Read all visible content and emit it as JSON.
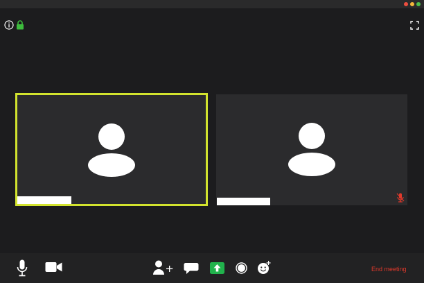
{
  "window": {
    "controls": [
      "close",
      "minimize",
      "maximize"
    ]
  },
  "top_bar": {
    "icons": [
      "info-icon",
      "lock-icon",
      "fullscreen-icon"
    ],
    "lock_color": "#3dbd3d"
  },
  "participants": [
    {
      "tile": "participant-tile-1",
      "active_speaker": true,
      "highlight_color": "#d2e32e",
      "muted": false
    },
    {
      "tile": "participant-tile-2",
      "active_speaker": false,
      "muted": true,
      "muted_icon_color": "#e1392b"
    }
  ],
  "toolbar": {
    "left_icons": [
      "microphone-icon",
      "video-camera-icon"
    ],
    "center_icons": [
      "add-participant-icon",
      "chat-icon",
      "share-screen-icon",
      "record-icon",
      "reactions-icon"
    ],
    "share_color": "#21b24c",
    "end_meeting_label": "End meeting",
    "end_meeting_color": "#e1392b"
  }
}
